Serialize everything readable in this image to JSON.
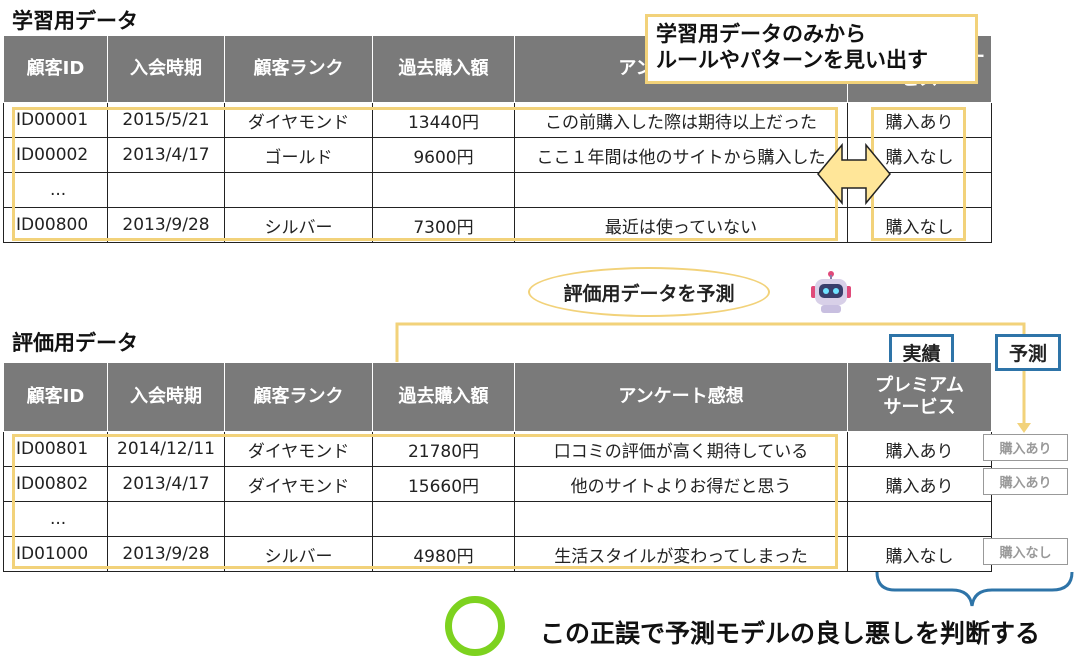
{
  "training": {
    "title": "学習用データ",
    "headers": [
      "顧客ID",
      "入会時期",
      "顧客ランク",
      "過去購入額",
      "アンケート感想",
      "プレミアム サービス"
    ],
    "rows": [
      {
        "id": "ID00001",
        "joined": "2015/5/21",
        "rank": "ダイヤモンド",
        "amount": "13440円",
        "survey": "この前購入した際は期待以上だった",
        "premium": "購入あり"
      },
      {
        "id": "ID00002",
        "joined": "2013/4/17",
        "rank": "ゴールド",
        "amount": "9600円",
        "survey": "ここ１年間は他のサイトから購入した",
        "premium": "購入なし"
      },
      {
        "id": "...",
        "joined": "",
        "rank": "",
        "amount": "",
        "survey": "",
        "premium": ""
      },
      {
        "id": "ID00800",
        "joined": "2013/9/28",
        "rank": "シルバー",
        "amount": "7300円",
        "survey": "最近は使っていない",
        "premium": "購入なし"
      }
    ],
    "callout_line1": "学習用データのみから",
    "callout_line2": "ルールやパターンを見い出す"
  },
  "bubble_text": "評価用データを予測",
  "evaluation": {
    "title": "評価用データ",
    "headers": [
      "顧客ID",
      "入会時期",
      "顧客ランク",
      "過去購入額",
      "アンケート感想",
      "プレミアム",
      "サービス"
    ],
    "rows": [
      {
        "id": "ID00801",
        "joined": "2014/12/11",
        "rank": "ダイヤモンド",
        "amount": "21780円",
        "survey": "口コミの評価が高く期待している",
        "premium": "購入あり",
        "predicted": "購入あり"
      },
      {
        "id": "ID00802",
        "joined": "2013/4/17",
        "rank": "ダイヤモンド",
        "amount": "15660円",
        "survey": "他のサイトよりお得だと思う",
        "premium": "購入あり",
        "predicted": "購入あり"
      },
      {
        "id": "...",
        "joined": "",
        "rank": "",
        "amount": "",
        "survey": "",
        "premium": "",
        "predicted": ""
      },
      {
        "id": "ID01000",
        "joined": "2013/9/28",
        "rank": "シルバー",
        "amount": "4980円",
        "survey": "生活スタイルが変わってしまった",
        "premium": "購入なし",
        "predicted": "購入なし"
      }
    ],
    "actual_label": "実績",
    "predicted_label": "予測"
  },
  "conclusion": "この正誤で予測モデルの良し悪しを判断する",
  "colors": {
    "header_bg": "#7a7a7a",
    "highlight": "#f2d27a",
    "tag_border": "#2e74a8",
    "ring": "#7dd21f",
    "arrow_fill": "#ffe699"
  },
  "icons": [
    "robot-icon",
    "double-arrow-icon",
    "circle-ok-icon"
  ]
}
